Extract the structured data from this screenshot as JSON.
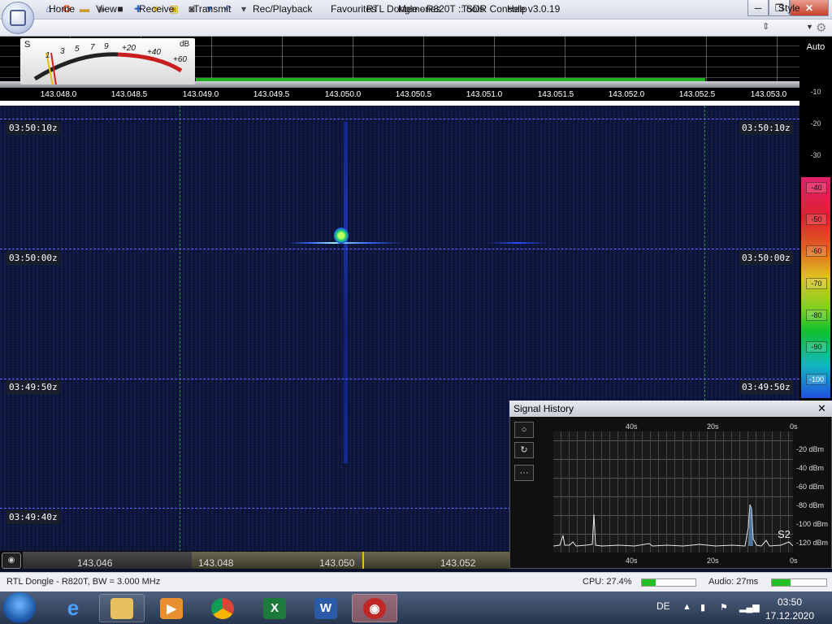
{
  "window": {
    "title": "RTL Dongle - R820T :: SDR Console v3.0.19"
  },
  "quick_access": [
    "home-icon",
    "help-icon",
    "folder-icon",
    "play-icon",
    "stop-icon",
    "add-icon",
    "star-icon",
    "lock-icon",
    "camera-icon",
    "pipette-icon",
    "undo-icon"
  ],
  "menu": [
    "Home",
    "View",
    "Receive",
    "Transmit",
    "Rec/Playback",
    "Favourites",
    "Memories",
    "Tools",
    "Help"
  ],
  "style_label": "Style",
  "smeter": {
    "s_label": "S",
    "db_label": "dB",
    "scale": [
      "1",
      "3",
      "5",
      "7",
      "9",
      "+20",
      "+40",
      "+60"
    ]
  },
  "spectrum": {
    "freq_ticks": [
      "143.048.0",
      "143.048.5",
      "143.049.0",
      "143.049.5",
      "143.050.0",
      "143.050.5",
      "143.051.0",
      "143.051.5",
      "143.052.0",
      "143.052.5",
      "143.053.0"
    ]
  },
  "waterfall": {
    "times": [
      "03:50:10z",
      "03:50:00z",
      "03:49:50z",
      "03:49:40z"
    ]
  },
  "level_panel": {
    "auto_label": "Auto",
    "db_ticks": [
      "-10",
      "-20",
      "-30"
    ],
    "color_ticks": [
      "-40",
      "-50",
      "-60",
      "-70",
      "-80",
      "-90",
      "-100"
    ]
  },
  "signal_history": {
    "title": "Signal History",
    "close": "✕",
    "buttons": [
      "○",
      "↻",
      "···"
    ],
    "x_top": [
      "40s",
      "20s",
      "0s"
    ],
    "x_bottom": [
      "40s",
      "20s",
      "0s"
    ],
    "y_labels": [
      "-20 dBm",
      "-40 dBm",
      "-60 dBm",
      "-80 dBm",
      "-100 dBm",
      "-120 dBm"
    ],
    "s_reading": "S2"
  },
  "tuning": {
    "freqs": [
      "143.046",
      "143.048",
      "143.050",
      "143.052"
    ]
  },
  "status": {
    "left": "RTL Dongle - R820T, BW = 3.000 MHz",
    "cpu": "CPU: 27.4%",
    "cpu_level": 0.25,
    "audio": "Audio: 27ms",
    "audio_level": 0.35
  },
  "taskbar": {
    "apps": [
      "internet-explorer",
      "file-explorer",
      "media-player",
      "chrome",
      "excel",
      "word",
      "sdr-console"
    ],
    "language": "DE",
    "time": "03:50",
    "date": "17.12.2020"
  },
  "colors": {
    "passband": "#1fb01f",
    "accent": "#e8c000"
  }
}
